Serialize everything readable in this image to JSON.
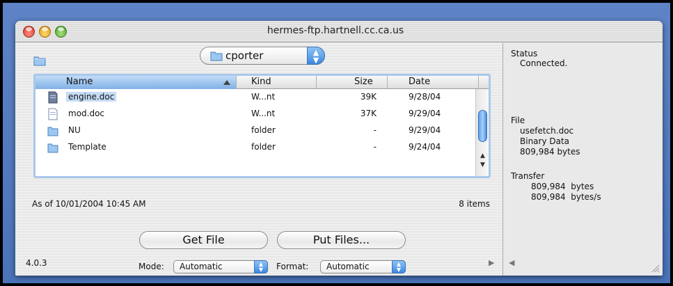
{
  "window": {
    "title": "hermes-ftp.hartnell.cc.ca.us"
  },
  "path_popup": {
    "label": "cporter"
  },
  "table": {
    "columns": {
      "name": "Name",
      "kind": "Kind",
      "size": "Size",
      "date": "Date"
    },
    "rows": [
      {
        "name": "engine.doc",
        "kind": "W...nt",
        "size": "39K",
        "date": "9/28/04",
        "icon": "document-icon",
        "selected": true
      },
      {
        "name": "mod.doc",
        "kind": "W...nt",
        "size": "37K",
        "date": "9/29/04",
        "icon": "document-icon",
        "selected": false
      },
      {
        "name": "NU",
        "kind": "folder",
        "size": "-",
        "date": "9/29/04",
        "icon": "folder-icon",
        "selected": false
      },
      {
        "name": "Template",
        "kind": "folder",
        "size": "-",
        "date": "9/24/04",
        "icon": "folder-icon",
        "selected": false
      }
    ]
  },
  "status": {
    "as_of": "As of 10/01/2004 10:45 AM",
    "count": "8 items"
  },
  "buttons": {
    "get_file": "Get File",
    "put_files": "Put Files..."
  },
  "mode": {
    "label": "Mode:",
    "value": "Automatic"
  },
  "format": {
    "label": "Format:",
    "value": "Automatic"
  },
  "version": "4.0.3",
  "drawer": {
    "status_heading": "Status",
    "status_value": "Connected.",
    "file_heading": "File",
    "file_name": "usefetch.doc",
    "file_type": "Binary Data",
    "file_bytes": "809,984 bytes",
    "transfer_heading": "Transfer",
    "transfer_bytes": "809,984  bytes",
    "transfer_rate": "809,984  bytes/s"
  },
  "colors": {
    "desktop_blue": "#5e83c6",
    "selection": "#c4dcf6",
    "aqua_blue": "#3b88e0"
  }
}
